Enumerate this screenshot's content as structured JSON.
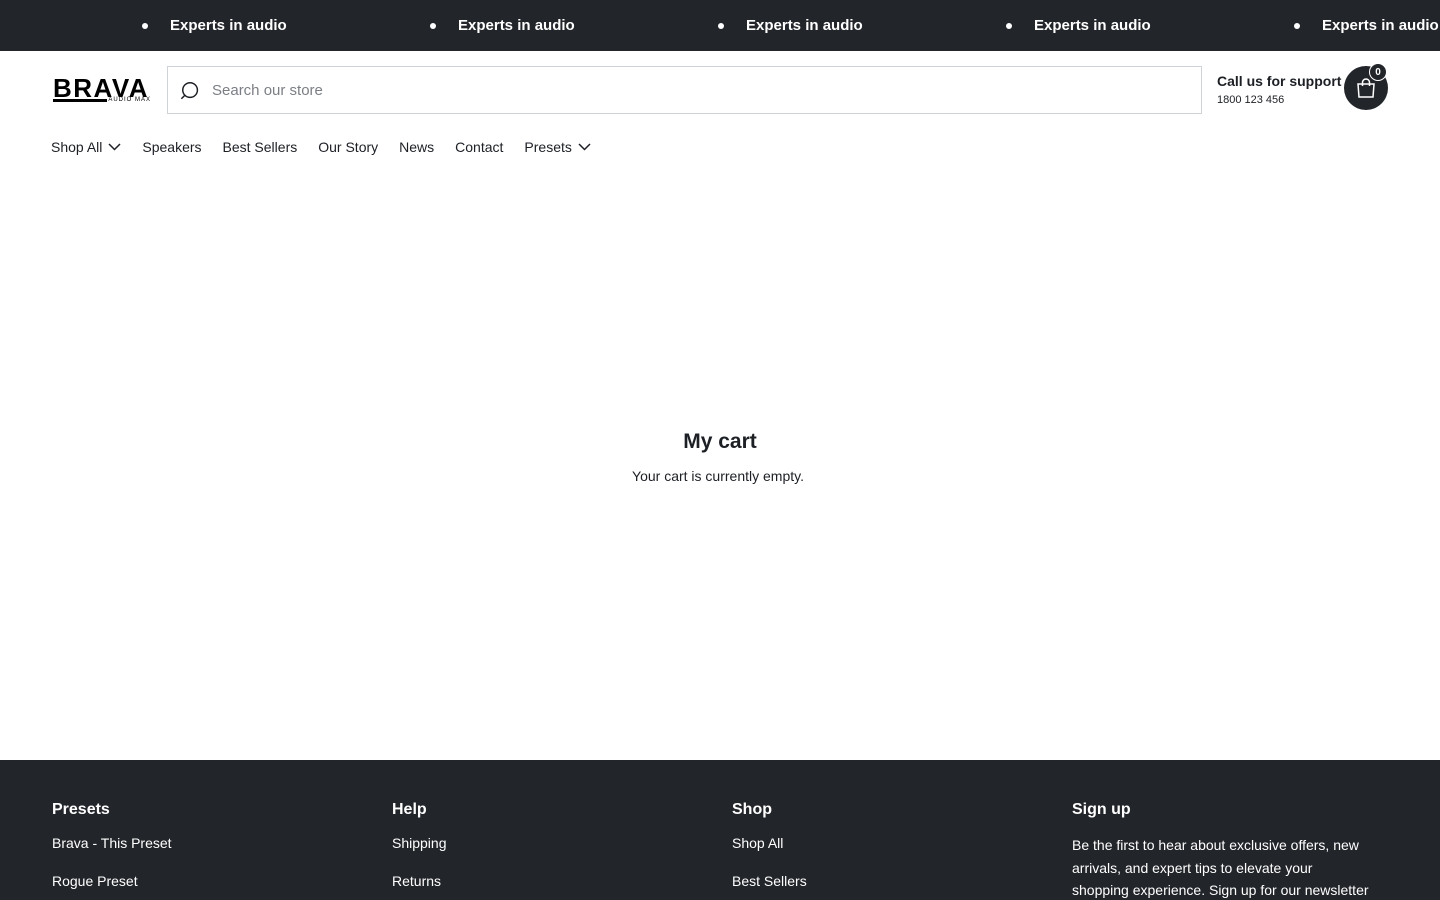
{
  "announcement": {
    "items": [
      "Experts in audio",
      "Experts in audio",
      "Experts in audio",
      "Experts in audio",
      "Experts in audio"
    ]
  },
  "header": {
    "logo_text": "BRAVA",
    "logo_subtext": "AUDIO MAX",
    "search_placeholder": "Search our store",
    "support_title": "Call us for support",
    "support_phone": "1800 123 456",
    "cart_count": "0"
  },
  "nav": {
    "items": [
      {
        "label": "Shop All",
        "dropdown": true
      },
      {
        "label": "Speakers",
        "dropdown": false
      },
      {
        "label": "Best Sellers",
        "dropdown": false
      },
      {
        "label": "Our Story",
        "dropdown": false
      },
      {
        "label": "News",
        "dropdown": false
      },
      {
        "label": "Contact",
        "dropdown": false
      },
      {
        "label": "Presets",
        "dropdown": true
      }
    ]
  },
  "main": {
    "title": "My cart",
    "empty_message": "Your cart is currently empty."
  },
  "footer": {
    "presets": {
      "heading": "Presets",
      "links": [
        "Brava - This Preset",
        "Rogue Preset"
      ]
    },
    "help": {
      "heading": "Help",
      "links": [
        "Shipping",
        "Returns"
      ]
    },
    "shop": {
      "heading": "Shop",
      "links": [
        "Shop All",
        "Best Sellers"
      ]
    },
    "signup": {
      "heading": "Sign up",
      "text": "Be the first to hear about exclusive offers, new arrivals, and expert tips to elevate your shopping experience. Sign up for our newsletter today!"
    }
  },
  "colors": {
    "dark": "#22252a",
    "text": "#1c1f24",
    "border": "#cfd2d6"
  },
  "icons": [
    "search-icon",
    "cart-icon",
    "chevron-down-icon"
  ]
}
